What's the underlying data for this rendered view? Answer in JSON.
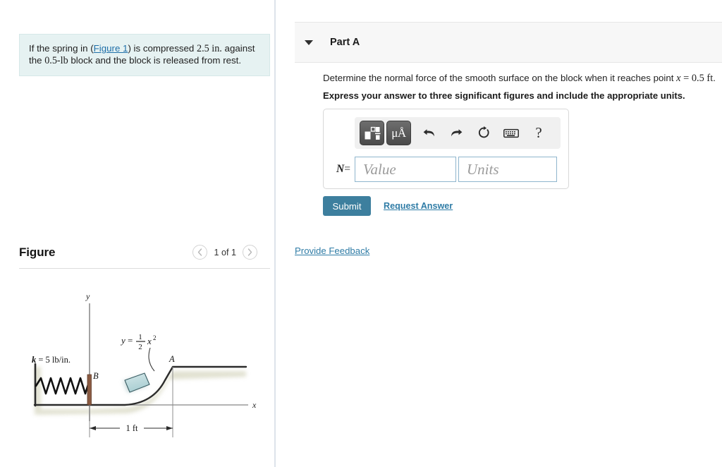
{
  "problem": {
    "text_before_link": "If the spring in (",
    "figure_link": "Figure 1",
    "text_after_link": ") is compressed ",
    "compression": "2.5 in.",
    "text_mid": " against the ",
    "weight": "0.5-lb",
    "text_end": " block and the block is released from rest."
  },
  "figure_panel": {
    "title": "Figure",
    "prev_icon": "chevron-left-icon",
    "next_icon": "chevron-right-icon",
    "counter": "1 of 1"
  },
  "figure_diagram": {
    "y_axis_label": "y",
    "x_axis_label": "x",
    "curve_equation_lhs": "y",
    "curve_equation_eq": "=",
    "curve_equation_frac_num": "1",
    "curve_equation_frac_den": "2",
    "curve_equation_var": "x",
    "curve_equation_exp": "2",
    "spring_label": "k = 5 lb/in.",
    "point_b": "B",
    "point_a": "A",
    "dimension_label": "1 ft"
  },
  "part": {
    "caret_icon": "caret-down-icon",
    "title": "Part A",
    "question_prefix": "Determine the normal force of the smooth surface on the block when it reaches point ",
    "question_var": "x",
    "question_eq": " = ",
    "question_value": "0.5 ft",
    "question_suffix": ".",
    "instruction": "Express your answer to three significant figures and include the appropriate units."
  },
  "toolbar": {
    "template_icon": "math-template-icon",
    "units_icon": "micro-angstrom-units-icon",
    "units_label": "μÅ",
    "undo_icon": "undo-arrow-icon",
    "redo_icon": "redo-arrow-icon",
    "reset_icon": "reset-circular-arrow-icon",
    "keyboard_icon": "keyboard-icon",
    "help_icon": "help-question-icon",
    "help_label": "?"
  },
  "answer": {
    "variable_label": "N",
    "equals": "=",
    "value_placeholder": "Value",
    "units_placeholder": "Units",
    "value_text": "",
    "units_text": ""
  },
  "actions": {
    "submit_label": "Submit",
    "request_answer_label": "Request Answer",
    "provide_feedback_label": "Provide Feedback"
  },
  "colors": {
    "problem_background": "#e6f2f2",
    "submit_background": "#3d7f9e",
    "link": "#2f7ca6",
    "field_border": "#8fb5cd",
    "part_header_background": "#f7f7f7",
    "block_fill": "#bcd9dc",
    "surface_shadow": "#cdcdb4"
  }
}
